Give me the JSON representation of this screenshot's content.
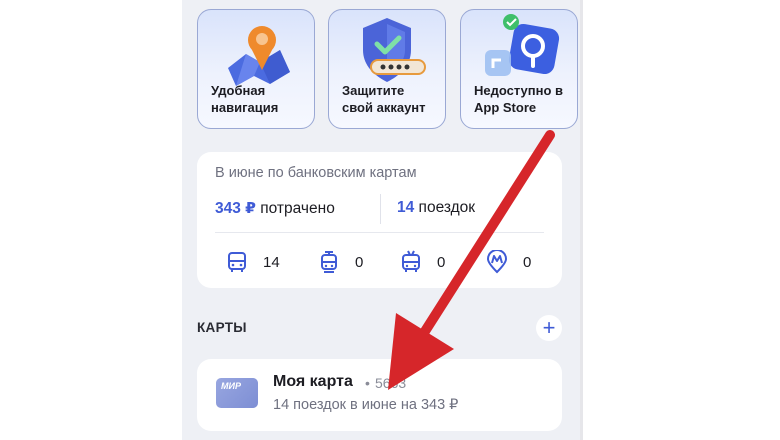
{
  "tiles": [
    {
      "label": "Удобная\nнавигация",
      "icon": "map-pin-icon"
    },
    {
      "label": "Защитите\nсвой аккаунт",
      "icon": "shield-password-icon"
    },
    {
      "label": "Недоступно в\nApp Store",
      "icon": "app-store-check-icon"
    }
  ],
  "stats": {
    "title": "В июне по банковским картам",
    "spent_value": "343 ₽",
    "spent_label": " потрачено",
    "trips_value": "14",
    "trips_label": " поездок",
    "transport": [
      {
        "type": "bus",
        "icon": "bus-icon",
        "count": "14"
      },
      {
        "type": "tram",
        "icon": "tram-icon",
        "count": "0"
      },
      {
        "type": "trolleybus",
        "icon": "trolleybus-icon",
        "count": "0"
      },
      {
        "type": "metro",
        "icon": "metro-icon",
        "count": "0"
      }
    ]
  },
  "cards_section": {
    "title": "КАРТЫ",
    "add_label": "+"
  },
  "card": {
    "brand": "МИР",
    "name": "Моя карта",
    "separator": "•",
    "number": "5663",
    "subtitle": "14 поездок в июне на 343 ₽"
  },
  "colors": {
    "accent": "#3f5bd6",
    "arrow": "#d6262a",
    "background": "#eef0f5"
  }
}
